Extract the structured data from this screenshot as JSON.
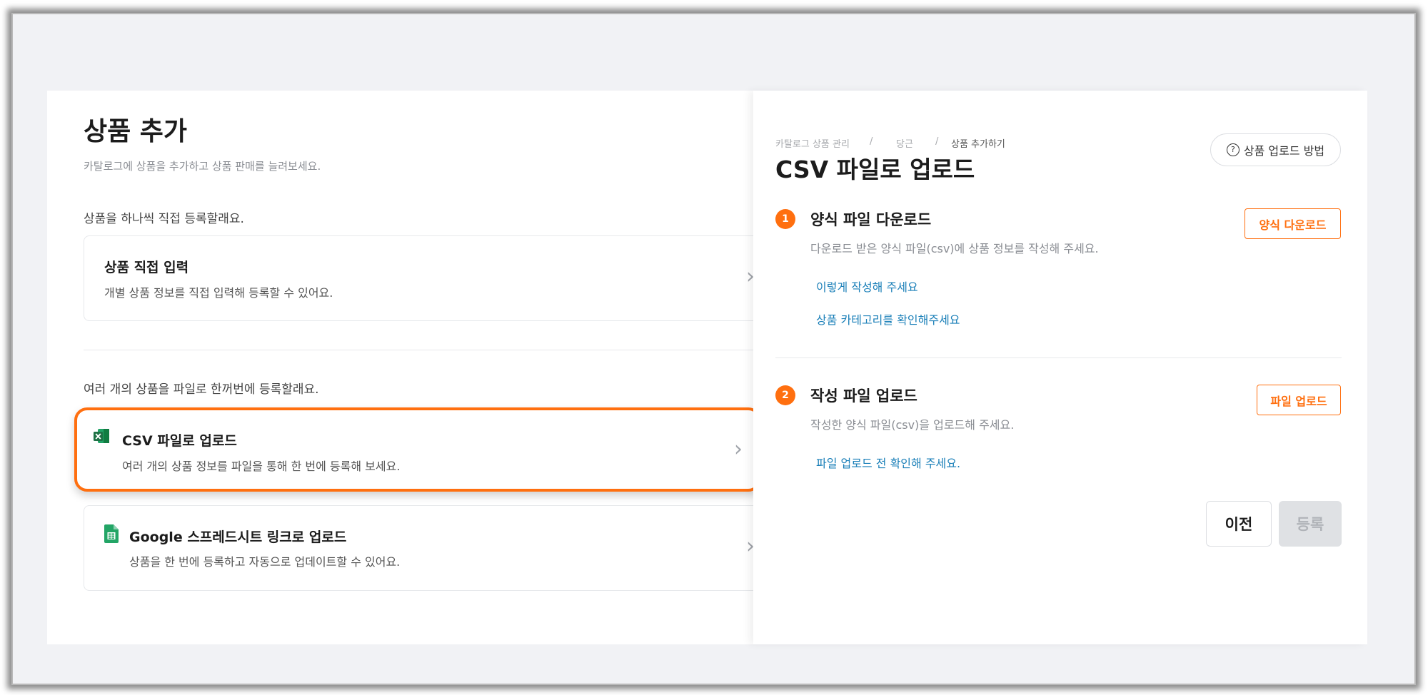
{
  "left": {
    "title": "상품 추가",
    "subtitle": "카탈로그에 상품을 추가하고 상품 판매를 늘려보세요.",
    "section_single": "상품을 하나씩 직접 등록할래요.",
    "section_bulk": "여러 개의 상품을 파일로 한꺼번에 등록할래요.",
    "cards": [
      {
        "title": "상품 직접 입력",
        "desc": "개별 상품 정보를 직접 입력해 등록할 수 있어요.",
        "icon": "none"
      },
      {
        "title": "CSV 파일로 업로드",
        "desc": "여러 개의 상품 정보를 파일을 통해 한 번에 등록해 보세요.",
        "icon": "excel-icon"
      },
      {
        "title": "Google 스프레드시트 링크로 업로드",
        "desc": "상품을 한 번에 등록하고 자동으로 업데이트할 수 있어요.",
        "icon": "google-sheets-icon"
      }
    ],
    "chevron": "›"
  },
  "right": {
    "breadcrumb": [
      "카탈로그 상품 관리",
      "/",
      "당근",
      "/",
      "상품 추가하기"
    ],
    "title": "CSV 파일로 업로드",
    "help_button": "상품 업로드 방법",
    "help_icon": "?",
    "steps": [
      {
        "num": "1",
        "title": "양식 파일 다운로드",
        "desc": "다운로드 받은 양식 파일(csv)에 상품 정보를 작성해 주세요.",
        "button": "양식 다운로드",
        "links": [
          "이렇게 작성해 주세요",
          "상품 카테고리를 확인해주세요"
        ]
      },
      {
        "num": "2",
        "title": "작성 파일 업로드",
        "desc": "작성한 양식 파일(csv)을 업로드해 주세요.",
        "button": "파일 업로드",
        "links": [
          "파일 업로드 전 확인해 주세요."
        ]
      }
    ],
    "prev_button": "이전",
    "submit_button": "등록"
  },
  "colors": {
    "accent": "#ff6f0f",
    "link": "#1a7fb8",
    "excel_green": "#1e7145",
    "sheets_green": "#23a566"
  }
}
